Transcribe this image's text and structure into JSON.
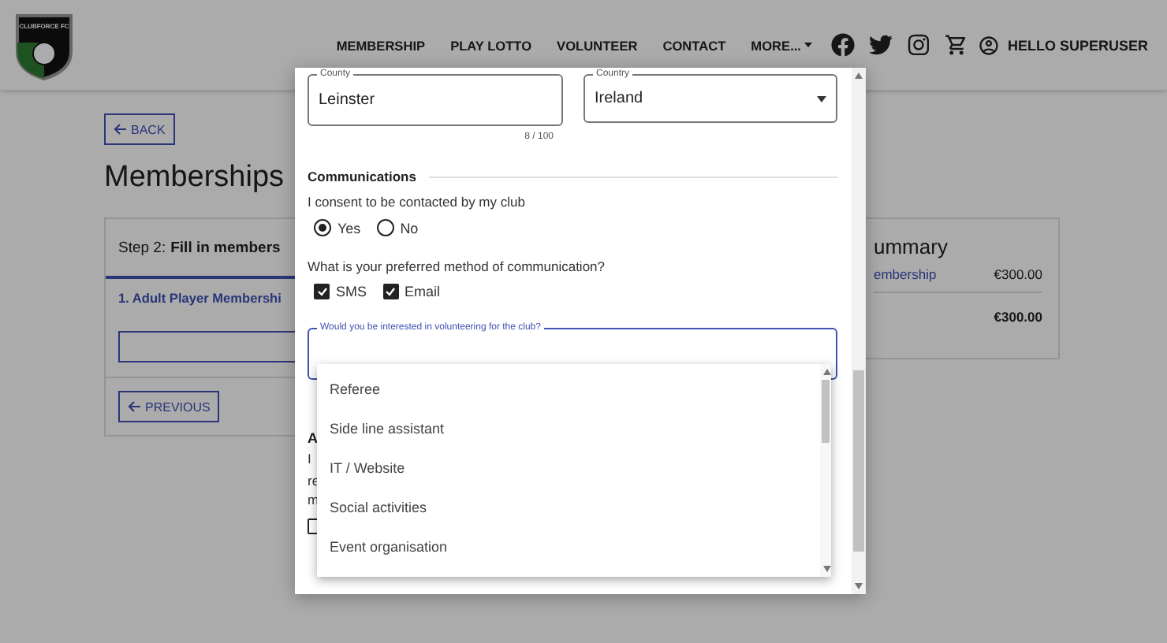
{
  "header": {
    "logo_text": "CLUBFORCE FC",
    "nav": [
      {
        "label": "MEMBERSHIP",
        "kind": "link"
      },
      {
        "label": "PLAY LOTTO",
        "kind": "link"
      },
      {
        "label": "VOLUNTEER",
        "kind": "link"
      },
      {
        "label": "CONTACT",
        "kind": "link"
      },
      {
        "label": "MORE...",
        "kind": "dropdown"
      }
    ],
    "user": "HELLO SUPERUSER"
  },
  "page": {
    "back_button": "BACK",
    "title": "Memberships",
    "step": {
      "prefix": "Step 2:",
      "title": "Fill in members"
    },
    "item": "1. Adult Player Membershi",
    "previous_button": "PREVIOUS",
    "summary": {
      "title": "ummary",
      "rows": [
        {
          "label": "embership",
          "amount": "€300.00"
        }
      ],
      "total": "€300.00"
    }
  },
  "modal": {
    "county": {
      "label": "County",
      "value": "Leinster",
      "counter": "8 / 100"
    },
    "country": {
      "label": "Country",
      "value": "Ireland"
    },
    "section": "Communications",
    "consent_question": "I consent to be contacted by my club",
    "radios": [
      {
        "label": "Yes",
        "selected": true
      },
      {
        "label": "No",
        "selected": false
      }
    ],
    "method_question": "What is your preferred method of communication?",
    "checkboxes": [
      {
        "label": "SMS",
        "checked": true
      },
      {
        "label": "Email",
        "checked": true
      }
    ],
    "volunteer": {
      "label": "Would you be interested in volunteering for the club?"
    },
    "options": [
      "Referee",
      "Side line assistant",
      "IT / Website",
      "Social activities",
      "Event organisation"
    ],
    "next_section": {
      "heading": "A",
      "lines": [
        "I",
        "re",
        "m"
      ],
      "checkbox_checked": false
    }
  }
}
